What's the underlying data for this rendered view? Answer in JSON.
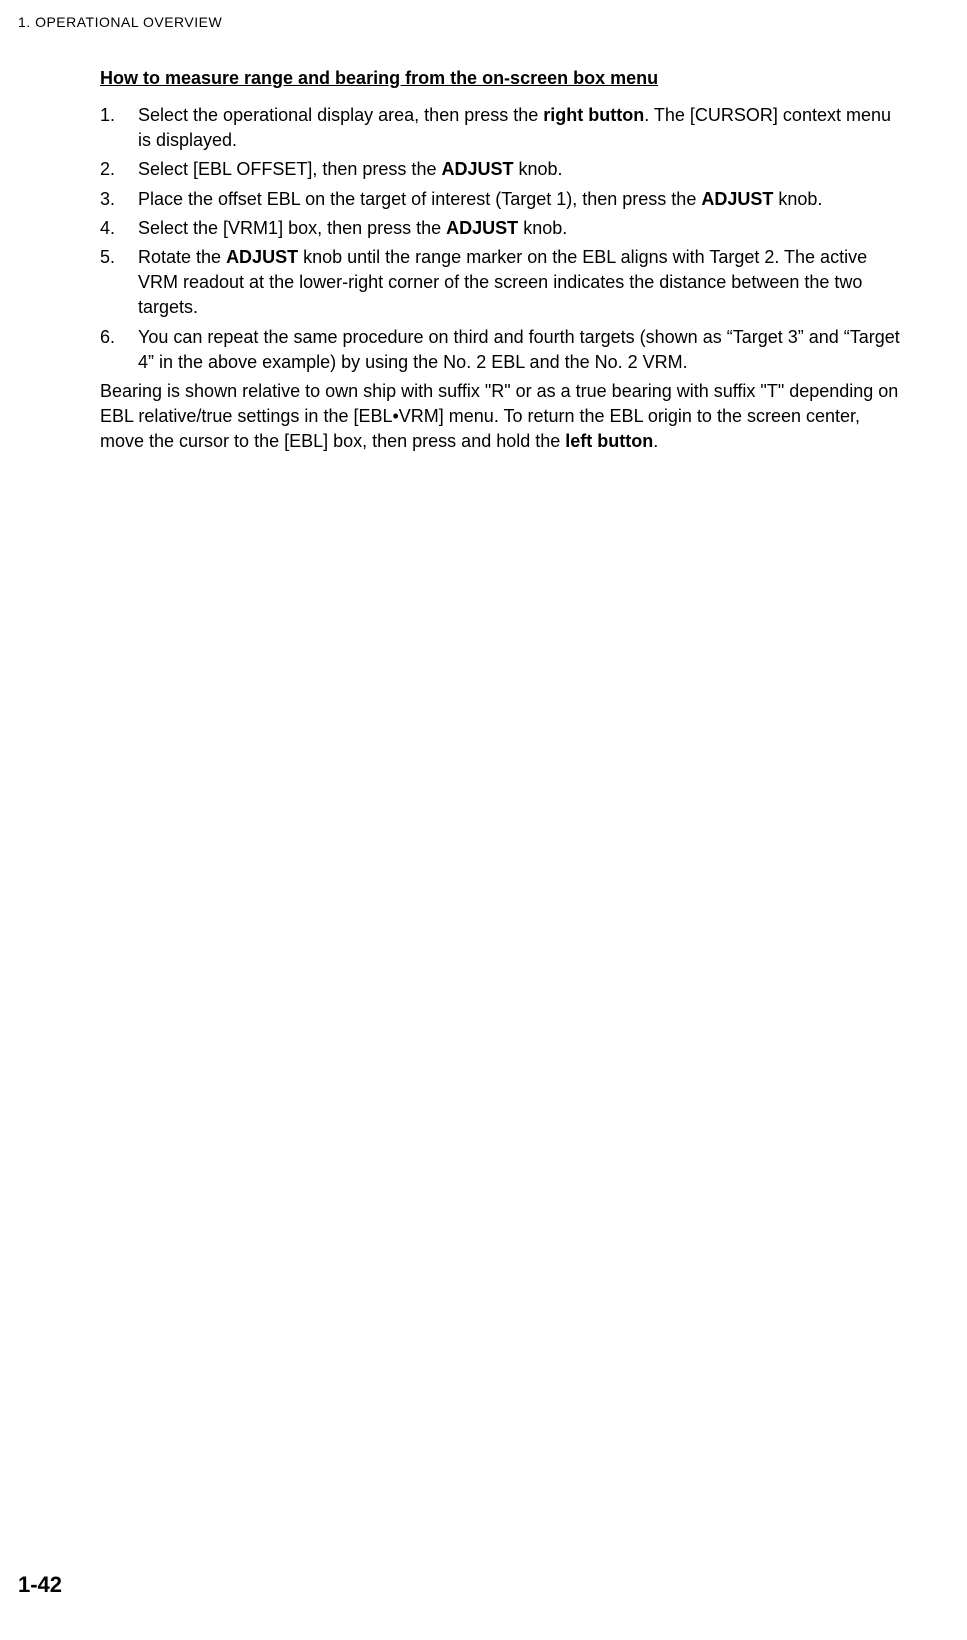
{
  "chapter": "1.  OPERATIONAL OVERVIEW",
  "section_title": "How to measure range and bearing from the on-screen box menu",
  "steps": [
    {
      "num": "1.",
      "parts": [
        {
          "t": "Select the operational display area, then press the ",
          "b": false
        },
        {
          "t": "right button",
          "b": true
        },
        {
          "t": ". The [CURSOR] context menu is displayed.",
          "b": false
        }
      ]
    },
    {
      "num": "2.",
      "parts": [
        {
          "t": "Select [EBL OFFSET], then press the ",
          "b": false
        },
        {
          "t": "ADJUST",
          "b": true
        },
        {
          "t": " knob.",
          "b": false
        }
      ]
    },
    {
      "num": "3.",
      "parts": [
        {
          "t": "Place the offset EBL on the target of interest (Target 1), then press the ",
          "b": false
        },
        {
          "t": "ADJUST",
          "b": true
        },
        {
          "t": " knob.",
          "b": false
        }
      ]
    },
    {
      "num": "4.",
      "parts": [
        {
          "t": "Select the [VRM1] box, then press the ",
          "b": false
        },
        {
          "t": "ADJUST",
          "b": true
        },
        {
          "t": " knob.",
          "b": false
        }
      ]
    },
    {
      "num": "5.",
      "parts": [
        {
          "t": "Rotate the ",
          "b": false
        },
        {
          "t": "ADJUST",
          "b": true
        },
        {
          "t": " knob until the range marker on the EBL aligns with Target 2. The active VRM readout at the lower-right corner of the screen indicates the distance between the two targets.",
          "b": false
        }
      ]
    },
    {
      "num": "6.",
      "parts": [
        {
          "t": "You can repeat the same procedure on third and fourth targets (shown as “Target 3” and “Target 4” in the above example) by using the No. 2 EBL and the No. 2 VRM.",
          "b": false
        }
      ]
    }
  ],
  "paragraph_parts": [
    {
      "t": "Bearing is shown relative to own ship with suffix \"R\" or as a true bearing with suffix \"T\" depending on EBL relative/true settings in the [EBL•VRM] menu. To return the EBL origin to the screen center, move the cursor to the [EBL] box, then press and hold the ",
      "b": false
    },
    {
      "t": "left button",
      "b": true
    },
    {
      "t": ".",
      "b": false
    }
  ],
  "page_number": "1-42"
}
